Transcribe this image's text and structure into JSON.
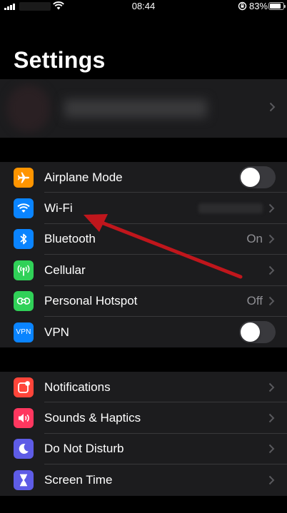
{
  "status_bar": {
    "time": "08:44",
    "battery_percent": "83%",
    "battery_level": 0.83
  },
  "page": {
    "title": "Settings"
  },
  "colors": {
    "airplane": "#ff9500",
    "wifi": "#0a84ff",
    "bluetooth": "#0a84ff",
    "cellular": "#30d158",
    "hotspot": "#30d158",
    "vpn": "#0a84ff",
    "notifications": "#ff453a",
    "sounds": "#ff375f",
    "dnd": "#5e5ce6",
    "screen_time": "#5e5ce6",
    "annotation_arrow": "#c0161c"
  },
  "group1": {
    "airplane": {
      "label": "Airplane Mode",
      "icon": "airplane-icon",
      "toggle_on": false
    },
    "wifi": {
      "label": "Wi-Fi",
      "icon": "wifi-icon"
    },
    "bluetooth": {
      "label": "Bluetooth",
      "icon": "bluetooth-icon",
      "value": "On"
    },
    "cellular": {
      "label": "Cellular",
      "icon": "cellular-antenna-icon"
    },
    "hotspot": {
      "label": "Personal Hotspot",
      "icon": "hotspot-icon",
      "value": "Off"
    },
    "vpn": {
      "label": "VPN",
      "icon": "vpn-icon",
      "icon_text": "VPN",
      "toggle_on": false
    }
  },
  "group2": {
    "notifications": {
      "label": "Notifications",
      "icon": "notifications-icon"
    },
    "sounds": {
      "label": "Sounds & Haptics",
      "icon": "speaker-icon"
    },
    "dnd": {
      "label": "Do Not Disturb",
      "icon": "moon-icon"
    },
    "screen_time": {
      "label": "Screen Time",
      "icon": "hourglass-icon"
    }
  }
}
